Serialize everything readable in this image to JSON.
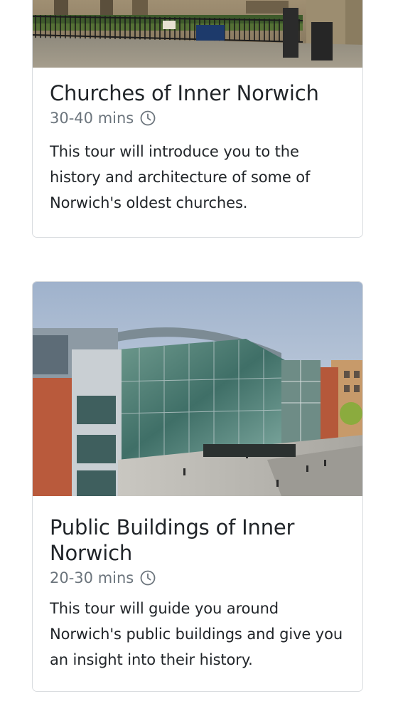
{
  "tours": [
    {
      "title": "Churches of Inner Norwich",
      "duration": "30-40 mins",
      "description": "This tour will introduce you to the history and architecture of some of Norwich's oldest churches.",
      "image_subject": "church-railings-photo",
      "duration_icon": "clock-icon"
    },
    {
      "title": "Public Buildings of Inner Norwich",
      "duration": "20-30 mins",
      "description": "This tour will guide you around Norwich's public buildings and give you an insight into their history.",
      "image_subject": "forum-glass-building-photo",
      "duration_icon": "clock-icon"
    }
  ],
  "colors": {
    "text": "#212529",
    "muted": "#6c757d",
    "border": "#d9dcdf"
  }
}
